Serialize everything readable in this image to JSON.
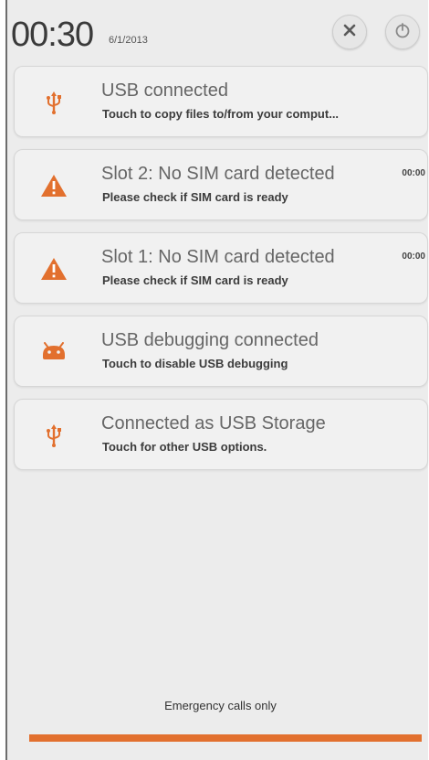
{
  "status": {
    "time": "00:30",
    "date": "6/1/2013"
  },
  "header": {
    "close_icon": "close-icon",
    "power_icon": "power-icon"
  },
  "notifications": [
    {
      "icon": "usb-icon",
      "title": "USB connected",
      "subtitle": "Touch to copy files to/from your comput..."
    },
    {
      "icon": "warning-icon",
      "title": "Slot 2: No SIM card detected",
      "subtitle": "Please check if SIM card is ready",
      "time": "00:00"
    },
    {
      "icon": "warning-icon",
      "title": "Slot 1: No SIM card detected",
      "subtitle": "Please check if SIM card is ready",
      "time": "00:00"
    },
    {
      "icon": "android-debug-icon",
      "title": "USB debugging connected",
      "subtitle": "Touch to disable USB debugging"
    },
    {
      "icon": "usb-icon",
      "title": "Connected as USB Storage",
      "subtitle": "Touch for other USB options."
    }
  ],
  "footer": {
    "carrier_text": "Emergency calls only"
  },
  "colors": {
    "accent": "#e2702e",
    "shade_background": "#ececec",
    "card_background": "#f1f1f1"
  }
}
